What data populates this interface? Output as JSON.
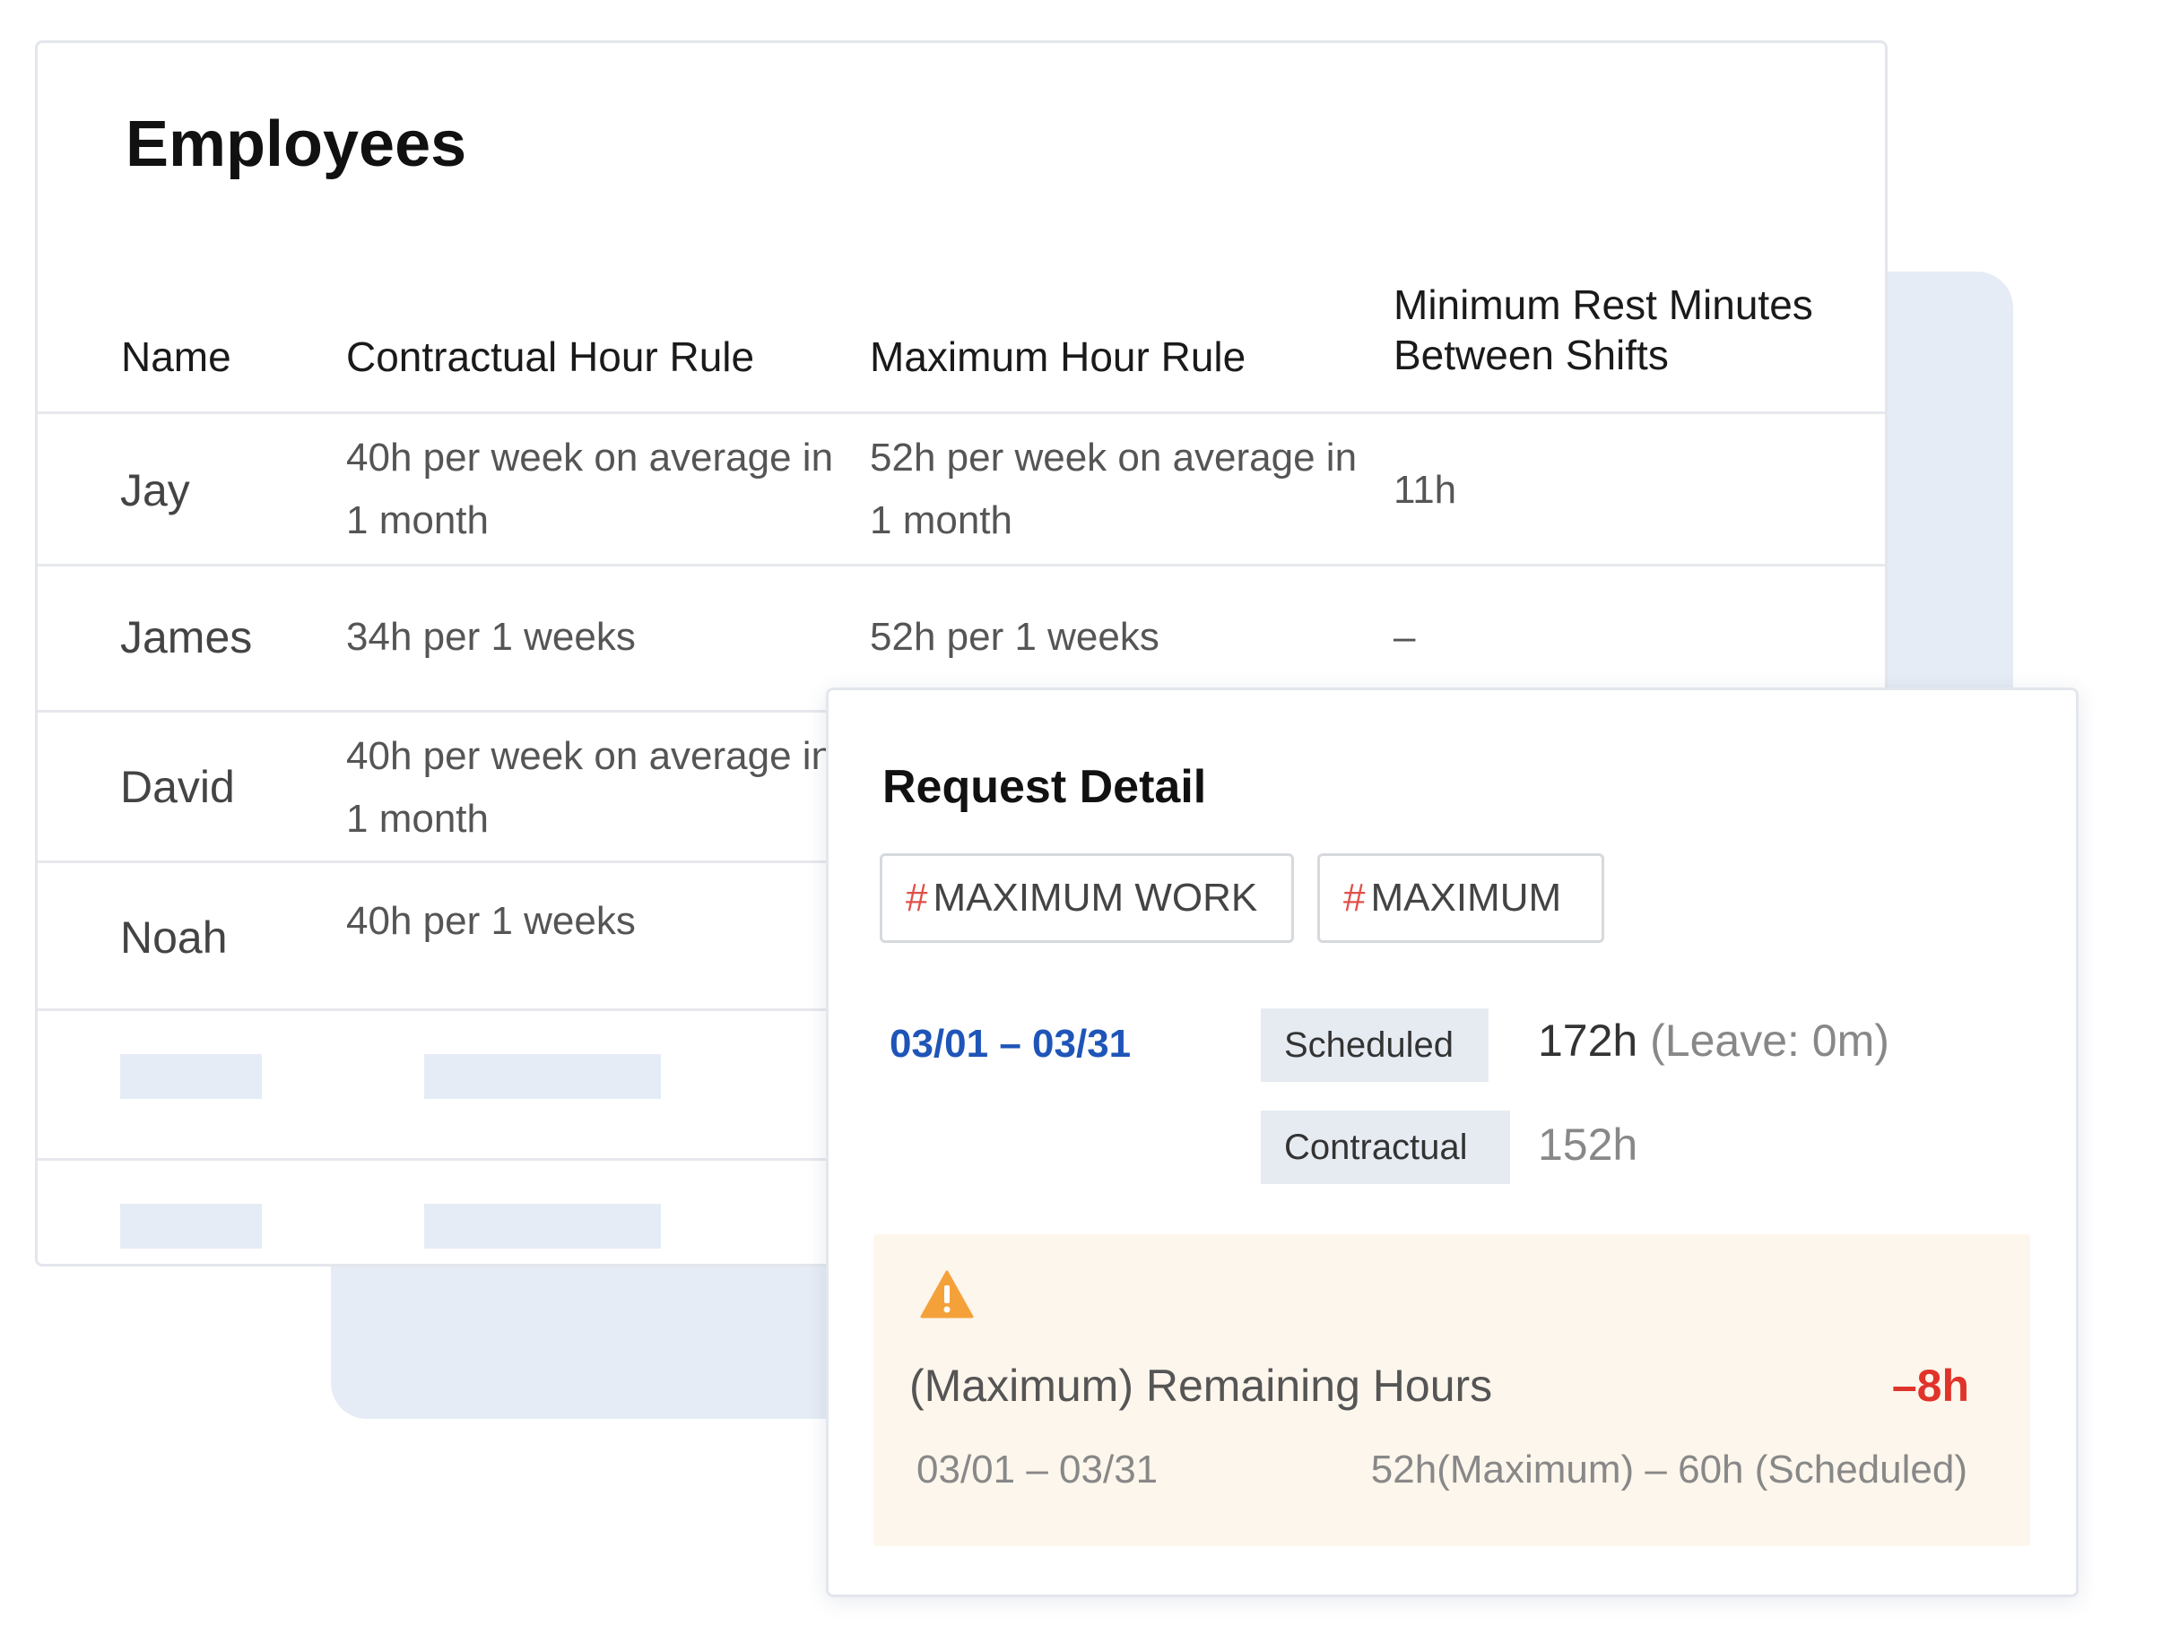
{
  "employees": {
    "title": "Employees",
    "columns": {
      "name": "Name",
      "contractual": "Contractual Hour Rule",
      "maximum": "Maximum Hour Rule",
      "rest": "Minimum Rest Minutes Between Shifts"
    },
    "rows": [
      {
        "name": "Jay",
        "contractual": "40h per week on average in 1 month",
        "maximum": "52h per week on average in 1 month",
        "rest": "11h"
      },
      {
        "name": "James",
        "contractual": "34h per 1 weeks",
        "maximum": "52h per 1 weeks",
        "rest": "–"
      },
      {
        "name": "David",
        "contractual": "40h per week on average in 1 month"
      },
      {
        "name": "Noah",
        "contractual": "40h per 1 weeks"
      }
    ]
  },
  "request_detail": {
    "title": "Request Detail",
    "tags": [
      {
        "hash": "#",
        "label": "MAXIMUM WORK"
      },
      {
        "hash": "#",
        "label": "MAXIMUM"
      }
    ],
    "period": "03/01 – 03/31",
    "scheduled_label": "Scheduled",
    "scheduled_value": "172h",
    "scheduled_leave": "(Leave: 0m)",
    "contractual_label": "Contractual",
    "contractual_value": "152h",
    "warning": {
      "icon": "warning-triangle-icon",
      "label": "(Maximum) Remaining Hours",
      "value": "–8h",
      "period": "03/01 – 03/31",
      "formula": "52h(Maximum) – 60h (Scheduled)"
    }
  },
  "colors": {
    "accent_blue": "#1f55b8",
    "alert_red": "#e0342b",
    "warning_orange": "#f5a13a",
    "warning_bg": "#fdf6ec",
    "placeholder": "#e6ecf6"
  }
}
